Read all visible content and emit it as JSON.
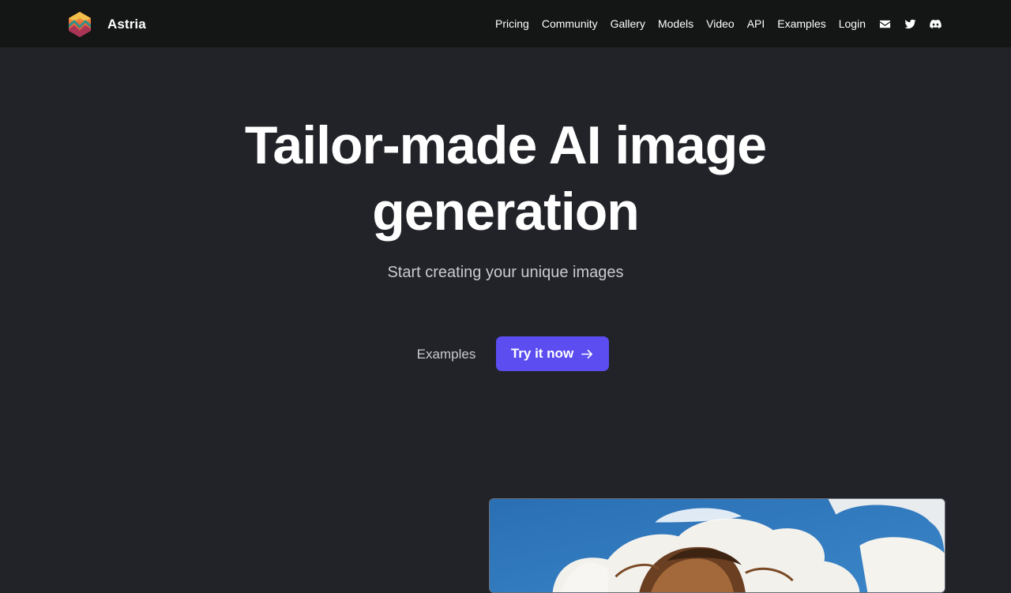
{
  "brand": {
    "name": "Astria",
    "logo_icon": "hexagon-mountain-logo"
  },
  "nav": {
    "links": [
      "Pricing",
      "Community",
      "Gallery",
      "Models",
      "Video",
      "API",
      "Examples",
      "Login"
    ],
    "icons": [
      "mail-icon",
      "twitter-icon",
      "discord-icon"
    ]
  },
  "hero": {
    "title": "Tailor-made AI image generation",
    "subtitle": "Start creating your unique images",
    "secondary_cta": "Examples",
    "primary_cta": "Try it now",
    "primary_cta_icon": "arrow-right-icon"
  },
  "preview": {
    "image": "sky-clouds-portrait-painting"
  },
  "colors": {
    "background": "#212328",
    "navbar": "#141515",
    "accent": "#5b4df0",
    "subtle_text": "#c9cbd0"
  }
}
